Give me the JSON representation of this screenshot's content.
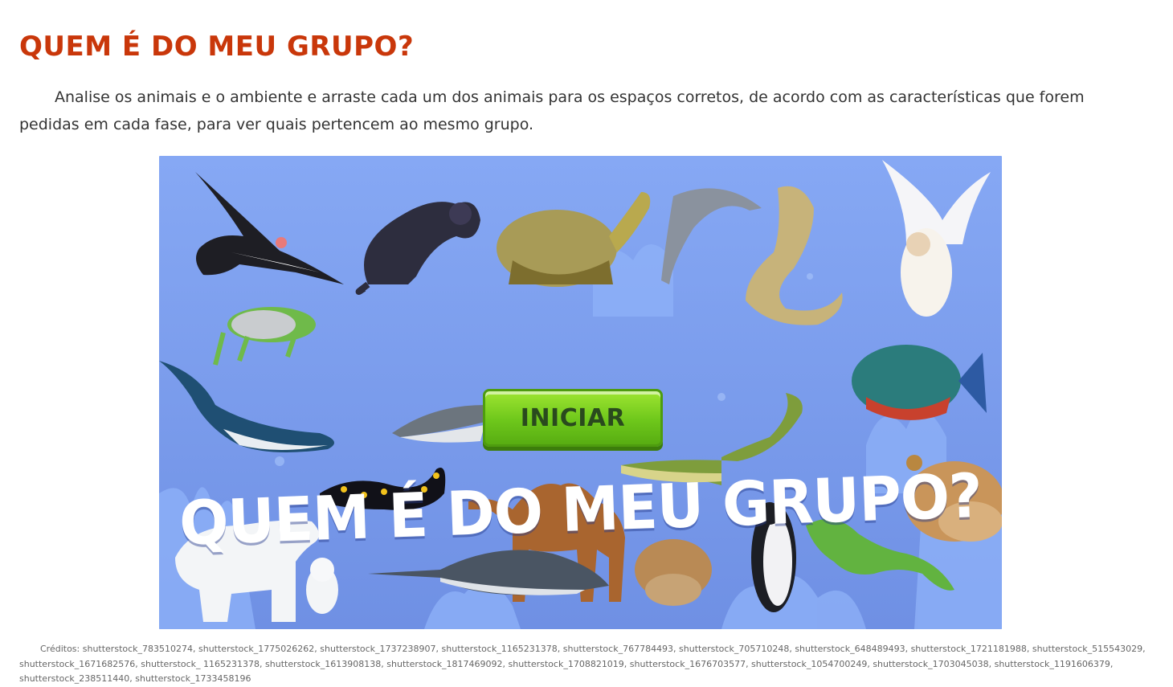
{
  "page": {
    "title": "QUEM É DO MEU GRUPO?",
    "title_color": "#c9370a",
    "intro": "Analise os animais e o ambiente e arraste cada um dos animais para os espaços corretos, de acordo com as características que forem pedidas em cada fase, para ver quais pertencem ao mesmo grupo."
  },
  "game": {
    "title": "QUEM É DO MEU GRUPO?",
    "start_label": "INICIAR",
    "background_color": "#7b9ef0",
    "button_color": "#7dd01f",
    "animals": [
      "condor",
      "monkey",
      "tortoise",
      "dolphin",
      "cobra",
      "owl",
      "frog",
      "whale",
      "piranha",
      "shark",
      "crocodile",
      "salamander",
      "toad",
      "camel",
      "polar-bear",
      "polar-bear-cub",
      "swordfish",
      "horned-frog",
      "penguin",
      "iguana"
    ]
  },
  "credits": "Créditos: shutterstock_783510274, shutterstock_1775026262, shutterstock_1737238907, shutterstock_1165231378, shutterstock_767784493, shutterstock_705710248, shutterstock_648489493, shutterstock_1721181988, shutterstock_515543029, shutterstock_1671682576, shutterstock_ 1165231378, shutterstock_1613908138, shutterstock_1817469092, shutterstock_1708821019, shutterstock_1676703577, shutterstock_1054700249, shutterstock_1703045038, shutterstock_1191606379, shutterstock_238511440, shutterstock_1733458196"
}
